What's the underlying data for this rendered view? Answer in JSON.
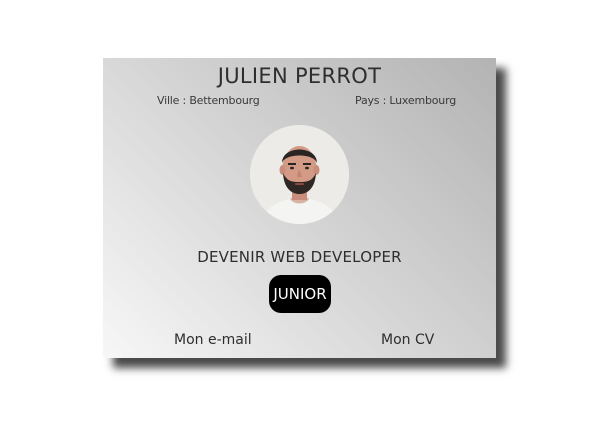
{
  "profile": {
    "name": "JULIEN PERROT",
    "city": "Ville : Bettembourg",
    "country": "Pays : Luxembourg",
    "headline": "DEVENIR WEB DEVELOPER",
    "level_badge": "JUNIOR"
  },
  "links": {
    "email": "Mon e-mail",
    "cv": "Mon CV"
  },
  "colors": {
    "badge_background": "#000000",
    "badge_text": "#ffffff",
    "card_gradient_dark": "#b3b3b3",
    "card_gradient_light": "#f7f7f7"
  }
}
